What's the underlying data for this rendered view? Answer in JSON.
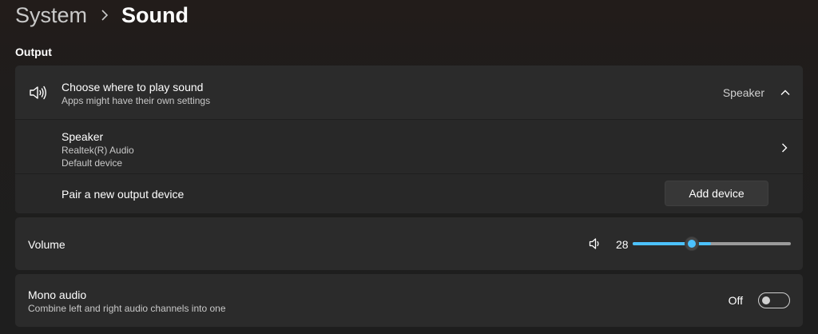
{
  "breadcrumb": {
    "parent": "System",
    "current": "Sound"
  },
  "output": {
    "section_label": "Output",
    "header": {
      "title": "Choose where to play sound",
      "subtitle": "Apps might have their own settings",
      "value": "Speaker",
      "icon": "speaker-icon"
    },
    "speaker": {
      "name": "Speaker",
      "driver": "Realtek(R) Audio",
      "status": "Default device"
    },
    "pair": {
      "label": "Pair a new output device",
      "button": "Add device"
    }
  },
  "volume": {
    "label": "Volume",
    "value": "28",
    "level_percent": 28,
    "accent": "#4cc2ff"
  },
  "mono": {
    "title": "Mono audio",
    "subtitle": "Combine left and right audio channels into one",
    "state": "Off"
  }
}
